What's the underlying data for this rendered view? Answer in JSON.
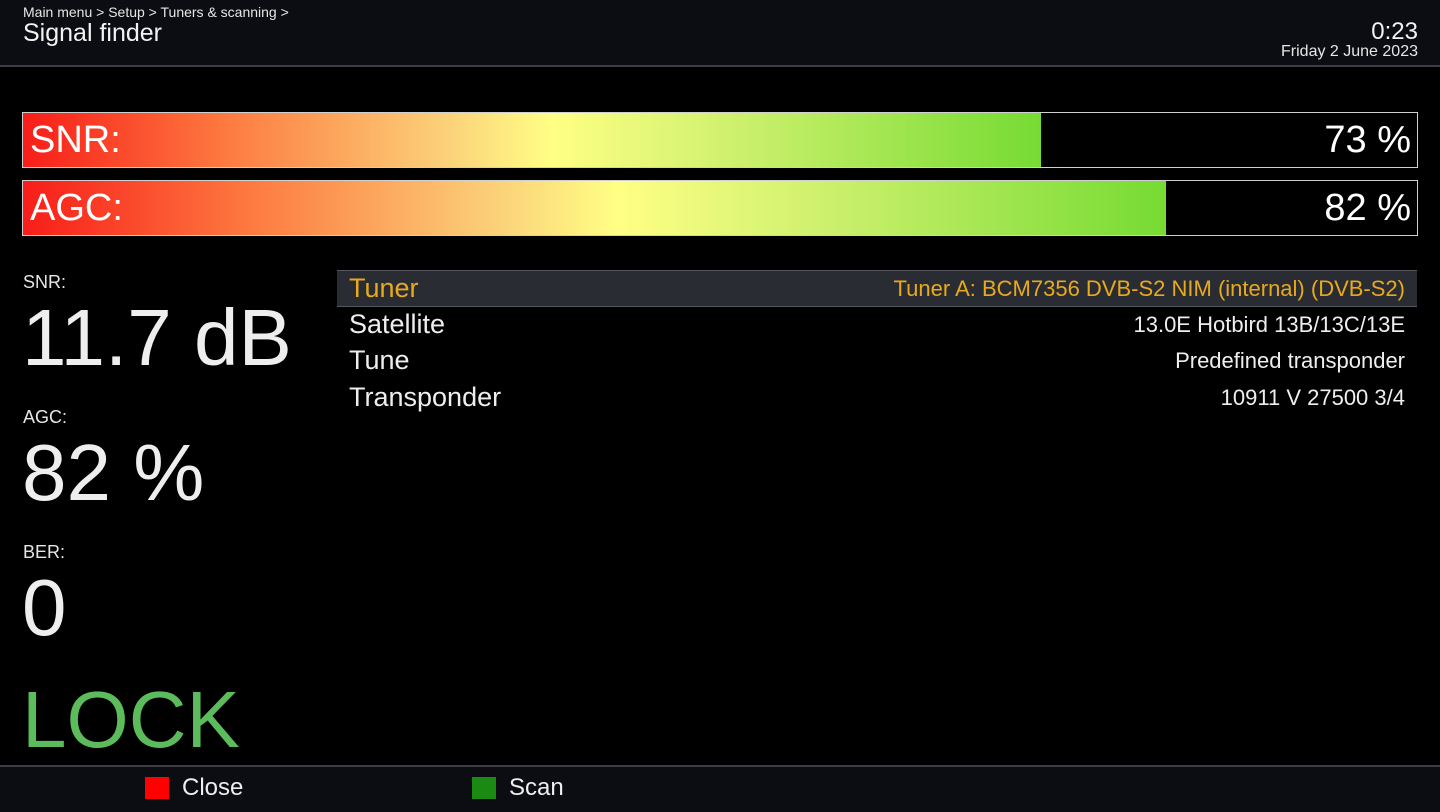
{
  "header": {
    "breadcrumb": "Main menu > Setup > Tuners & scanning >",
    "title": "Signal finder",
    "clock": "0:23",
    "date": "Friday  2 June 2023"
  },
  "bars": {
    "snr": {
      "label": "SNR:",
      "value_text": "73 %",
      "level_percent": 73
    },
    "agc": {
      "label": "AGC:",
      "value_text": "82 %",
      "level_percent": 82
    }
  },
  "stats": {
    "snr": {
      "label": "SNR:",
      "value": "11.7 dB"
    },
    "agc": {
      "label": "AGC:",
      "value": "82 %"
    },
    "ber": {
      "label": "BER:",
      "value": "0"
    },
    "lock": "LOCK"
  },
  "config": [
    {
      "key": "Tuner",
      "value": "Tuner A: BCM7356 DVB-S2 NIM (internal) (DVB-S2)",
      "selected": true
    },
    {
      "key": "Satellite",
      "value": "13.0E Hotbird 13B/13C/13E",
      "selected": false
    },
    {
      "key": "Tune",
      "value": "Predefined transponder",
      "selected": false
    },
    {
      "key": "Transponder",
      "value": "10911 V 27500 3/4",
      "selected": false
    }
  ],
  "footer": {
    "red_label": "Close",
    "green_label": "Scan"
  },
  "colors": {
    "selected_text": "#e8a91c",
    "lock": "#5cbc5c",
    "red_key": "#ff0000",
    "green_key": "#1b8a12"
  }
}
